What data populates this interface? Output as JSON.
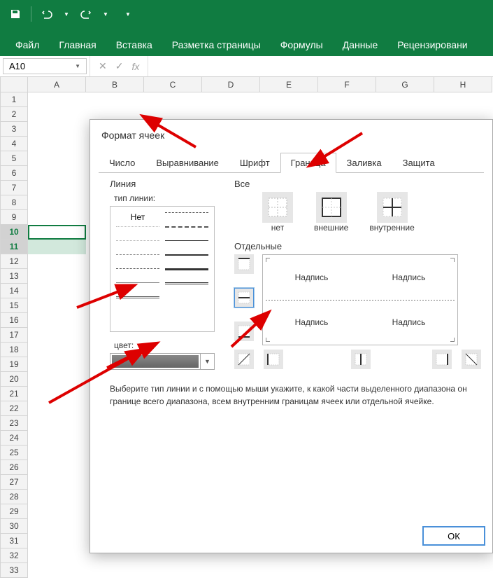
{
  "titlebar": {
    "save_icon": "save",
    "undo_icon": "undo",
    "redo_icon": "redo",
    "more_icon": "dropdown"
  },
  "ribbon": {
    "tabs": [
      "Файл",
      "Главная",
      "Вставка",
      "Разметка страницы",
      "Формулы",
      "Данные",
      "Рецензировани"
    ]
  },
  "namebox": {
    "value": "A10"
  },
  "fx": {
    "cancel": "✕",
    "confirm": "✓",
    "label": "fx"
  },
  "columns": [
    "A",
    "B",
    "C",
    "D",
    "E",
    "F",
    "G",
    "H"
  ],
  "rows": [
    "1",
    "2",
    "3",
    "4",
    "5",
    "6",
    "7",
    "8",
    "9",
    "10",
    "11",
    "12",
    "13",
    "14",
    "15",
    "16",
    "17",
    "18",
    "19",
    "20",
    "21",
    "22",
    "23",
    "24",
    "25",
    "26",
    "27",
    "28",
    "29",
    "30",
    "31",
    "32",
    "33"
  ],
  "dialog": {
    "title": "Формат ячеек",
    "tabs": [
      "Число",
      "Выравнивание",
      "Шрифт",
      "Граница",
      "Заливка",
      "Защита"
    ],
    "active_tab_index": 3,
    "line_group": "Линия",
    "line_type_label": "тип линии:",
    "none_label": "Нет",
    "color_label": "цвет:",
    "all_group": "Все",
    "presets": {
      "none": "нет",
      "outline": "внешние",
      "inside": "внутренние"
    },
    "individual_group": "Отдельные",
    "preview_text": "Надпись",
    "desc_line1": "Выберите тип линии и с помощью мыши укажите, к какой части выделенного диапазона он",
    "desc_line2": "границе всего диапазона, всем внутренним границам ячеек или отдельной ячейке.",
    "ok": "ОК"
  }
}
